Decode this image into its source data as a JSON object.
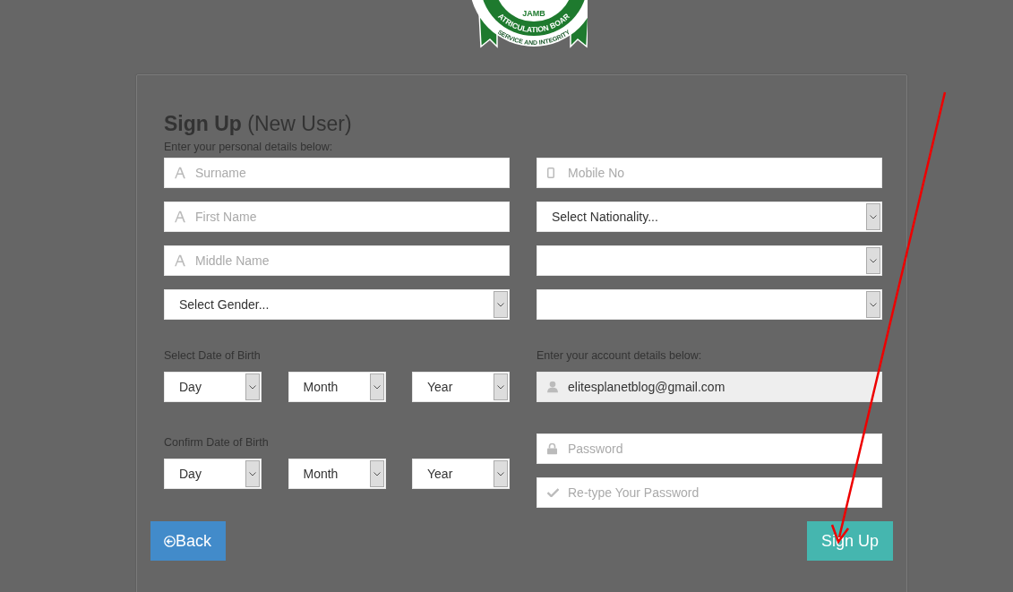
{
  "logo": {
    "texts": [
      "JAMB",
      "ATRICULATION BOAR",
      "SERVICE AND INTEGRITY"
    ]
  },
  "form": {
    "title": "Sign Up",
    "subtitle": "(New User)",
    "personal_hint": "Enter your personal details below:",
    "left_fields": [
      {
        "kind": "name",
        "placeholder": "Surname"
      },
      {
        "kind": "name",
        "placeholder": "First Name"
      },
      {
        "kind": "name",
        "placeholder": "Middle Name"
      },
      {
        "kind": "select",
        "value": "Select Gender..."
      }
    ],
    "right_fields": [
      {
        "kind": "mobile",
        "placeholder": "Mobile No"
      },
      {
        "kind": "select",
        "value": "Select Nationality..."
      },
      {
        "kind": "select"
      },
      {
        "kind": "select"
      }
    ],
    "dob_label": "Select Date of Birth",
    "dob": [
      {
        "value": "Day"
      },
      {
        "value": "Month"
      },
      {
        "value": "Year"
      }
    ],
    "confirm_dob_label": "Confirm Date of Birth",
    "confirm_dob": [
      {
        "value": "Day"
      },
      {
        "value": "Month"
      },
      {
        "value": "Year"
      }
    ],
    "account_hint": "Enter your account details below:",
    "account_fields": [
      {
        "kind": "email",
        "value": "elitesplanetblog@gmail.com"
      },
      {
        "kind": "password",
        "placeholder": "Password"
      },
      {
        "kind": "confirm",
        "placeholder": "Re-type Your Password"
      }
    ],
    "back_button": "Back",
    "sign_up_button": "Sign Up"
  }
}
